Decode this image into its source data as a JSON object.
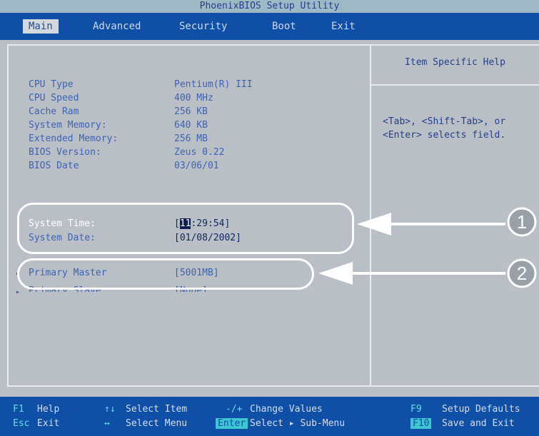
{
  "title": "PhoenixBIOS Setup Utility",
  "menu": [
    {
      "label": "Main",
      "active": true
    },
    {
      "label": "Advanced"
    },
    {
      "label": "Security"
    },
    {
      "label": "Boot"
    },
    {
      "label": "Exit"
    }
  ],
  "main": {
    "rows": [
      {
        "label": "CPU Type",
        "value": "Pentium(R) III"
      },
      {
        "label": "CPU Speed",
        "value": "400 MHz"
      },
      {
        "label": "Cache Ram",
        "value": "256 KB"
      },
      {
        "label": "System Memory:",
        "value": "640 KB"
      },
      {
        "label": "Extended Memory:",
        "value": "256 MB"
      },
      {
        "label": "BIOS Version:",
        "value": "Zeus 0.22"
      },
      {
        "label": "BIOS Date",
        "value": "03/06/01"
      }
    ],
    "time": {
      "label": "System Time:",
      "value_prefix": "[",
      "value_cursor": "11",
      "value_suffix": ":29:54]"
    },
    "date": {
      "label": "System Date:",
      "value": "[01/08/2002]"
    },
    "primary_master": {
      "label": "Primary Master",
      "value": "[5001MB]"
    },
    "primary_slave": {
      "label": "Primary Slave",
      "value": "[None]"
    }
  },
  "help": {
    "title": "Item Specific Help",
    "lines": [
      "<Tab>, <Shift-Tab>, or",
      "<Enter> selects field."
    ]
  },
  "callouts": [
    {
      "number": "1"
    },
    {
      "number": "2"
    }
  ],
  "status_bar": {
    "row1": [
      {
        "key": "F1",
        "desc": "Help"
      },
      {
        "key": "↑↓",
        "desc": "Select Item"
      },
      {
        "key": "-/+",
        "desc": "Change Values"
      },
      {
        "key": "F9",
        "desc": "Setup Defaults"
      }
    ],
    "row2": [
      {
        "key": "Esc",
        "desc": "Exit"
      },
      {
        "key": "↔",
        "desc": "Select Menu"
      },
      {
        "key": "Enter",
        "desc": "Select ▸ Sub-Menu"
      },
      {
        "key": "F10",
        "desc": "Save and Exit"
      }
    ]
  },
  "colors": {
    "menu_bar": "#0f4fa8",
    "body": "#b9bfc4",
    "value_text": "#3d63b6",
    "highlight_text": "#ffffff"
  }
}
